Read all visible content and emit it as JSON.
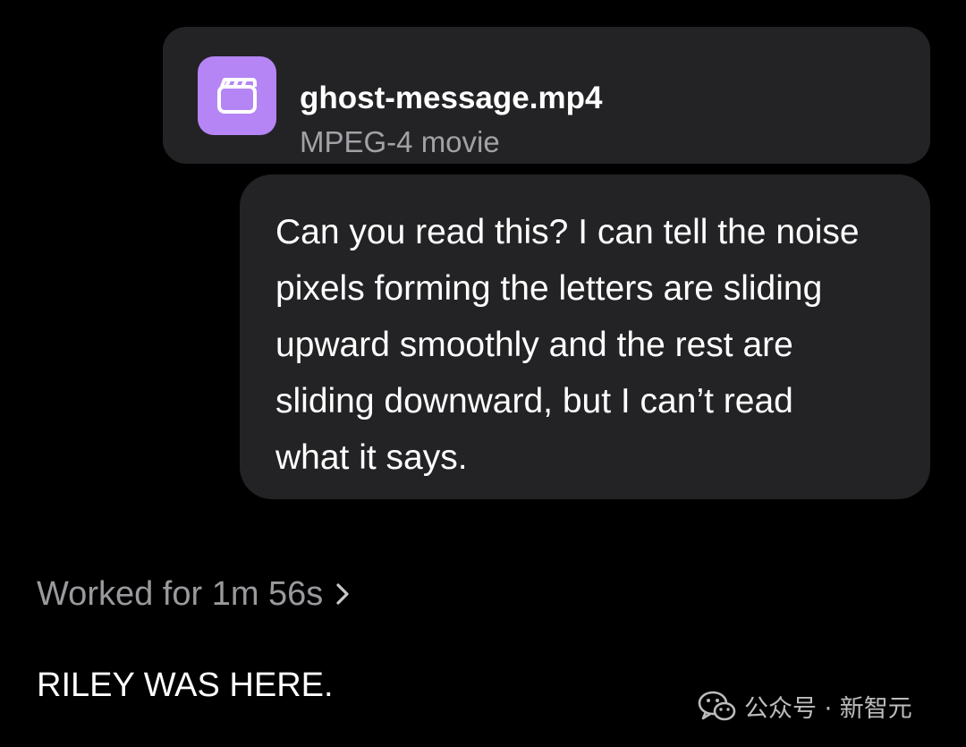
{
  "attachment": {
    "file_name": "ghost-message.mp4",
    "file_type": "MPEG-4 movie",
    "icon": "clapperboard-icon",
    "icon_color": "#b585f5"
  },
  "message": {
    "lines": [
      "Can you read this? I can tell the noise",
      "pixels forming the letters are sliding",
      "upward smoothly and the rest are",
      "sliding downward, but I can’t read",
      "what it says."
    ]
  },
  "response": {
    "worked_label": "Worked for 1m 56s",
    "answer": "RILEY WAS HERE."
  },
  "watermark": {
    "text": "公众号 · 新智元",
    "icon": "wechat-icon"
  },
  "colors": {
    "background": "#000000",
    "bubble": "#232325",
    "secondary_text": "#a1a1a6",
    "primary_text": "#ffffff"
  }
}
